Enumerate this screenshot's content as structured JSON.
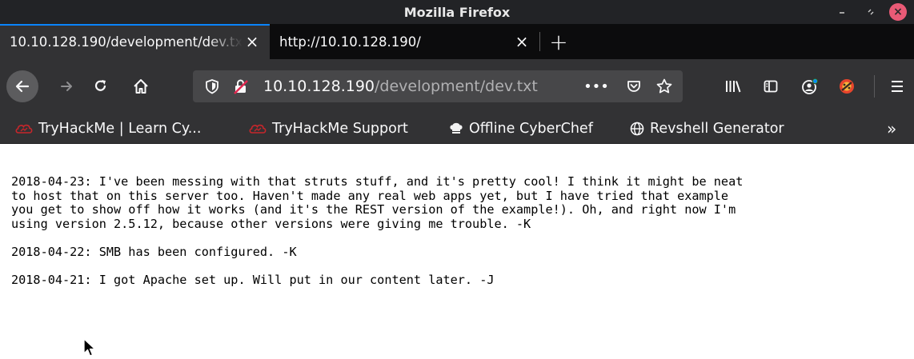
{
  "window": {
    "title": "Mozilla Firefox",
    "controls": [
      "minimize",
      "maximize",
      "close"
    ]
  },
  "tabs": [
    {
      "title": "10.10.128.190/development/dev.txt",
      "active": true,
      "close_label": "×"
    },
    {
      "title": "http://10.10.128.190/",
      "active": false,
      "close_label": "×"
    }
  ],
  "new_tab_label": "+",
  "navbar": {
    "back": "back-icon",
    "forward": "forward-icon",
    "reload": "reload-icon",
    "home": "home-icon",
    "url_host": "10.10.128.190",
    "url_path": "/development/dev.txt",
    "page_actions": "•••",
    "tools": [
      "library-icon",
      "sidebar-icon",
      "account-icon",
      "extension-icon",
      "menu-icon"
    ]
  },
  "bookmarks": [
    {
      "label": "TryHackMe | Learn Cy...",
      "icon": "tryhackme-icon"
    },
    {
      "label": "TryHackMe Support",
      "icon": "tryhackme-icon"
    },
    {
      "label": "Offline CyberChef",
      "icon": "chef-icon"
    },
    {
      "label": "Revshell Generator",
      "icon": "globe-icon"
    }
  ],
  "bookmarks_overflow": "»",
  "document": {
    "entries": [
      "2018-04-23: I've been messing with that struts stuff, and it's pretty cool! I think it might be neat\nto host that on this server too. Haven't made any real web apps yet, but I have tried that example\nyou get to show off how it works (and it's the REST version of the example!). Oh, and right now I'm\nusing version 2.5.12, because other versions were giving me trouble. -K",
      "2018-04-22: SMB has been configured. -K",
      "2018-04-21: I got Apache set up. Will put in our content later. -J"
    ]
  },
  "colors": {
    "titlebar": "#222326",
    "tabstrip": "#0c0c0d",
    "toolbar": "#323234",
    "urlbar": "#474749",
    "accent": "#0a84ff",
    "close": "#e95a76"
  }
}
